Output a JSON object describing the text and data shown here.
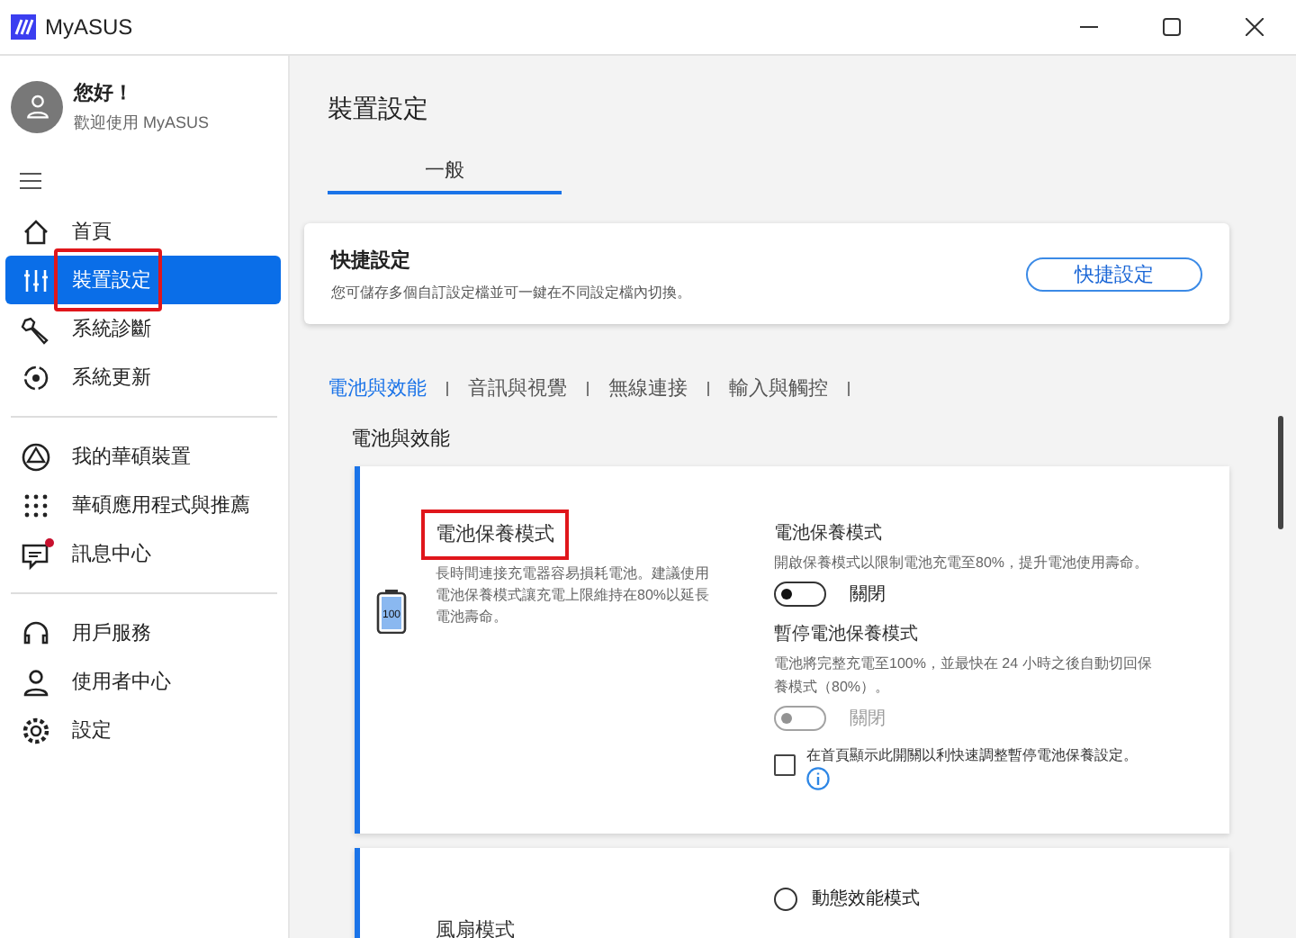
{
  "window": {
    "title": "MyASUS"
  },
  "user": {
    "greeting": "您好！",
    "subtitle": "歡迎使用 MyASUS"
  },
  "sidebar": {
    "groups": [
      [
        {
          "label": "首頁",
          "selected": false,
          "highlighted": false,
          "notification": false
        },
        {
          "label": "裝置設定",
          "selected": true,
          "highlighted": true,
          "notification": false
        },
        {
          "label": "系統診斷",
          "selected": false,
          "highlighted": false,
          "notification": false
        },
        {
          "label": "系統更新",
          "selected": false,
          "highlighted": false,
          "notification": false
        }
      ],
      [
        {
          "label": "我的華碩裝置",
          "selected": false,
          "highlighted": false,
          "notification": false
        },
        {
          "label": "華碩應用程式與推薦",
          "selected": false,
          "highlighted": false,
          "notification": false
        },
        {
          "label": "訊息中心",
          "selected": false,
          "highlighted": false,
          "notification": true
        }
      ],
      [
        {
          "label": "用戶服務",
          "selected": false,
          "highlighted": false,
          "notification": false
        },
        {
          "label": "使用者中心",
          "selected": false,
          "highlighted": false,
          "notification": false
        },
        {
          "label": "設定",
          "selected": false,
          "highlighted": false,
          "notification": false
        }
      ]
    ]
  },
  "page": {
    "title": "裝置設定",
    "tabs": [
      {
        "label": "一般",
        "selected": true
      }
    ],
    "quick_settings": {
      "title": "快捷設定",
      "description": "您可儲存多個自訂設定檔並可一鍵在不同設定檔內切換。",
      "button": "快捷設定"
    },
    "categories": [
      {
        "label": "電池與效能",
        "selected": true
      },
      {
        "label": "音訊與視覺",
        "selected": false
      },
      {
        "label": "無線連接",
        "selected": false
      },
      {
        "label": "輸入與觸控",
        "selected": false
      }
    ],
    "section_title": "電池與效能",
    "cards": [
      {
        "kind": "battery",
        "title": "電池保養模式",
        "title_highlighted": true,
        "description": "長時間連接充電器容易損耗電池。建議使用電池保養模式讓充電上限維持在80%以延長電池壽命。",
        "icon_text": "100",
        "settings": [
          {
            "kind": "toggle",
            "title": "電池保養模式",
            "description": "開啟保養模式以限制電池充電至80%，提升電池使用壽命。",
            "on": false,
            "disabled": false,
            "state_label": "關閉"
          },
          {
            "kind": "toggle",
            "title": "暫停電池保養模式",
            "description": "電池將完整充電至100%，並最快在 24 小時之後自動切回保養模式（80%）。",
            "on": false,
            "disabled": true,
            "state_label": "關閉"
          },
          {
            "kind": "checkbox",
            "label": "在首頁顯示此開關以利快速調整暫停電池保養設定。",
            "checked": false
          }
        ]
      },
      {
        "kind": "fan",
        "title": "風扇模式",
        "title_highlighted": false,
        "options": [
          {
            "label": "動態效能模式",
            "selected": false
          }
        ]
      }
    ]
  }
}
